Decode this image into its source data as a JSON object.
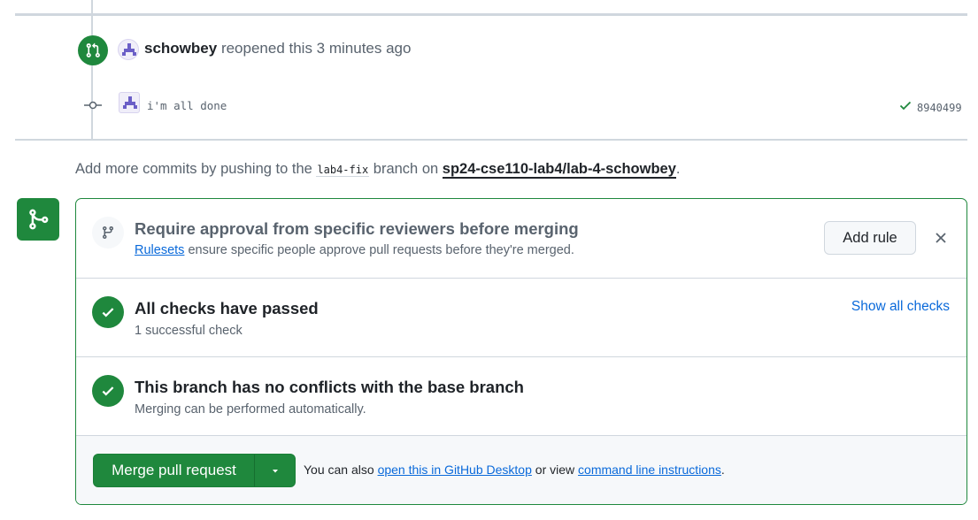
{
  "colors": {
    "accent_green": "#1f883d",
    "link_blue": "#0969da",
    "muted_text": "#59636e",
    "border": "#d0d7de"
  },
  "timeline": {
    "reopen": {
      "user": "schowbey",
      "action": "reopened this 3 minutes ago",
      "icon": "git-pull-request-icon"
    },
    "commit": {
      "message": "i'm all done",
      "sha": "8940499",
      "status_icon": "check-icon"
    }
  },
  "push_hint": {
    "prefix": "Add more commits by pushing to the",
    "branch": "lab4-fix",
    "middle": "branch on",
    "repo": "sp24-cse110-lab4/lab-4-schowbey",
    "suffix": "."
  },
  "merge_box": {
    "rules": {
      "title": "Require approval from specific reviewers before merging",
      "link": "Rulesets",
      "text": "ensure specific people approve pull requests before they're merged.",
      "button": "Add rule",
      "close_icon": "close-icon"
    },
    "checks": {
      "title": "All checks have passed",
      "subtitle": "1 successful check",
      "link": "Show all checks"
    },
    "conflicts": {
      "title": "This branch has no conflicts with the base branch",
      "subtitle": "Merging can be performed automatically."
    },
    "merge": {
      "button": "Merge pull request",
      "note_prefix": "You can also",
      "desktop_link": "open this in GitHub Desktop",
      "note_middle": "or view",
      "cli_link": "command line instructions",
      "note_suffix": "."
    }
  }
}
